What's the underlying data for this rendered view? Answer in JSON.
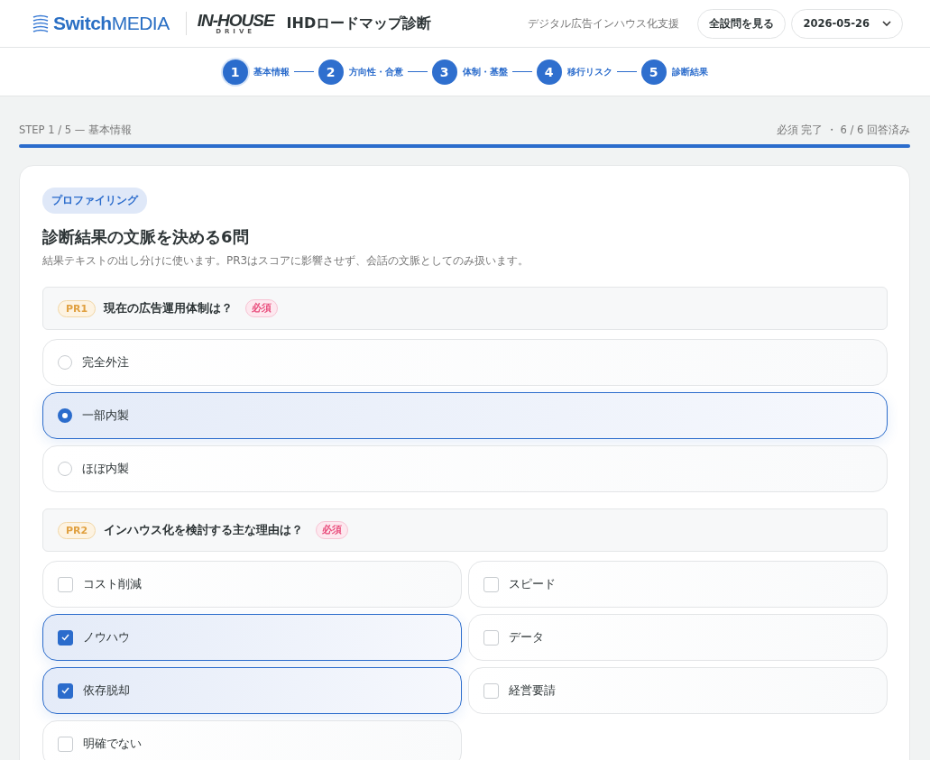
{
  "header": {
    "brand": {
      "name_bold": "Switch",
      "name_light": "MEDIA"
    },
    "product_logo": {
      "main": "IN-HOUSE",
      "sub": "DRIVE"
    },
    "title": "IHDロードマップ診断",
    "tagline": "デジタル広告インハウス化支援",
    "all_questions_button": "全設問を見る",
    "date_select": "2026-05-26"
  },
  "steps": [
    {
      "number": "1",
      "label": "基本情報",
      "selected": true
    },
    {
      "number": "2",
      "label": "方向性・合意",
      "selected": false
    },
    {
      "number": "3",
      "label": "体制・基盤",
      "selected": false
    },
    {
      "number": "4",
      "label": "移行リスク",
      "selected": false
    },
    {
      "number": "5",
      "label": "診断結果",
      "selected": false
    }
  ],
  "progress": {
    "step_label": "STEP 1 / 5 — 基本情報",
    "status": "必須 完了 ・ 6 / 6 回答済み",
    "level": 1
  },
  "section": {
    "tag": "プロファイリング",
    "title": "診断結果の文脈を決める6問",
    "description": "結果テキストの出し分けに使います。PR3はスコアに影響させず、会話の文脈としてのみ扱います。",
    "questions": [
      {
        "code": "PR1",
        "text": "現在の広告運用体制は？",
        "required_label": "必須",
        "kind": "radio",
        "options": [
          {
            "label": "完全外注",
            "selected": false
          },
          {
            "label": "一部内製",
            "selected": true
          },
          {
            "label": "ほぼ内製",
            "selected": false
          }
        ]
      },
      {
        "code": "PR2",
        "text": "インハウス化を検討する主な理由は？",
        "required_label": "必須",
        "kind": "checkbox",
        "options": [
          {
            "label": "コスト削減",
            "checked": false
          },
          {
            "label": "スピード",
            "checked": false
          },
          {
            "label": "ノウハウ",
            "checked": true
          },
          {
            "label": "データ",
            "checked": false
          },
          {
            "label": "依存脱却",
            "checked": true
          },
          {
            "label": "経営要請",
            "checked": false
          },
          {
            "label": "明確でない",
            "checked": false
          }
        ]
      }
    ]
  }
}
